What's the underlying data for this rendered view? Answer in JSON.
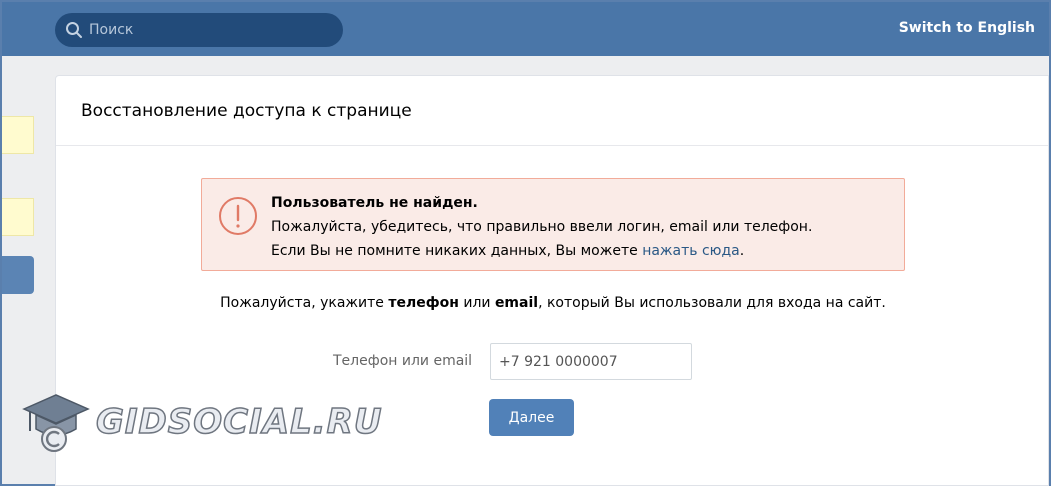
{
  "header": {
    "search_placeholder": "Поиск",
    "switch_language": "Switch to English"
  },
  "card": {
    "title": "Восстановление доступа к странице"
  },
  "error": {
    "title": "Пользователь не найден.",
    "line1": "Пожалуйста, убедитесь, что правильно ввели логин, email или телефон.",
    "line2_prefix": "Если Вы не помните никаких данных, Вы можете ",
    "line2_link": "нажать сюда",
    "line2_suffix": "."
  },
  "prompt": {
    "part1": "Пожалуйста, укажите ",
    "bold1": "телефон",
    "part2": " или ",
    "bold2": "email",
    "part3": ", который Вы использовали для входа на сайт."
  },
  "form": {
    "label": "Телефон или email",
    "value": "+7 921 0000007",
    "submit_label": "Далее"
  },
  "watermark": {
    "text": "GIDSOCIAL.RU"
  },
  "colors": {
    "header_bg": "#4a76a8",
    "search_bg": "#224b7a",
    "error_bg": "#faebe7",
    "error_border": "#f2ab99",
    "button_bg": "#5181b8",
    "link": "#2a5885"
  },
  "icons": {
    "search": "search-icon",
    "error": "exclamation-circle-icon",
    "watermark": "graduation-cap-icon"
  }
}
